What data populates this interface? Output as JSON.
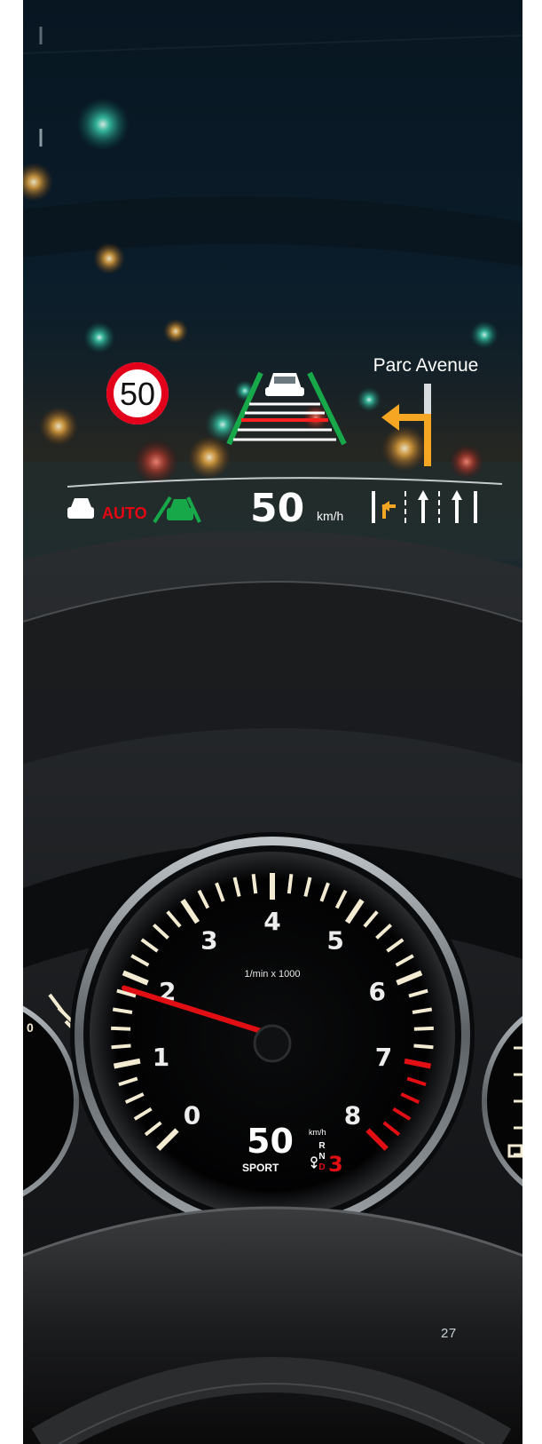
{
  "hud": {
    "speed_limit": "50",
    "street_name": "Parc Avenue",
    "adaptive_mode": "AUTO",
    "speed_value": "50",
    "speed_unit": "km/h"
  },
  "tachometer": {
    "scale_label": "1/min x 1000",
    "dial_numbers": [
      "0",
      "1",
      "2",
      "3",
      "4",
      "5",
      "6",
      "7",
      "8"
    ],
    "digital_speed": "50",
    "digital_unit": "km/h",
    "drive_mode": "SPORT",
    "gear_positions": [
      "R",
      "N",
      "D"
    ],
    "current_gear": "3",
    "needle_rpm": 1.85
  },
  "colors": {
    "hud_text": "#ffffff",
    "limit_ring": "#e3001b",
    "lane_green": "#17a84a",
    "nav_arrow": "#f5a623",
    "needle": "#e10f14",
    "dial_marks": "#f3ead2"
  },
  "page": {
    "number": "27"
  }
}
